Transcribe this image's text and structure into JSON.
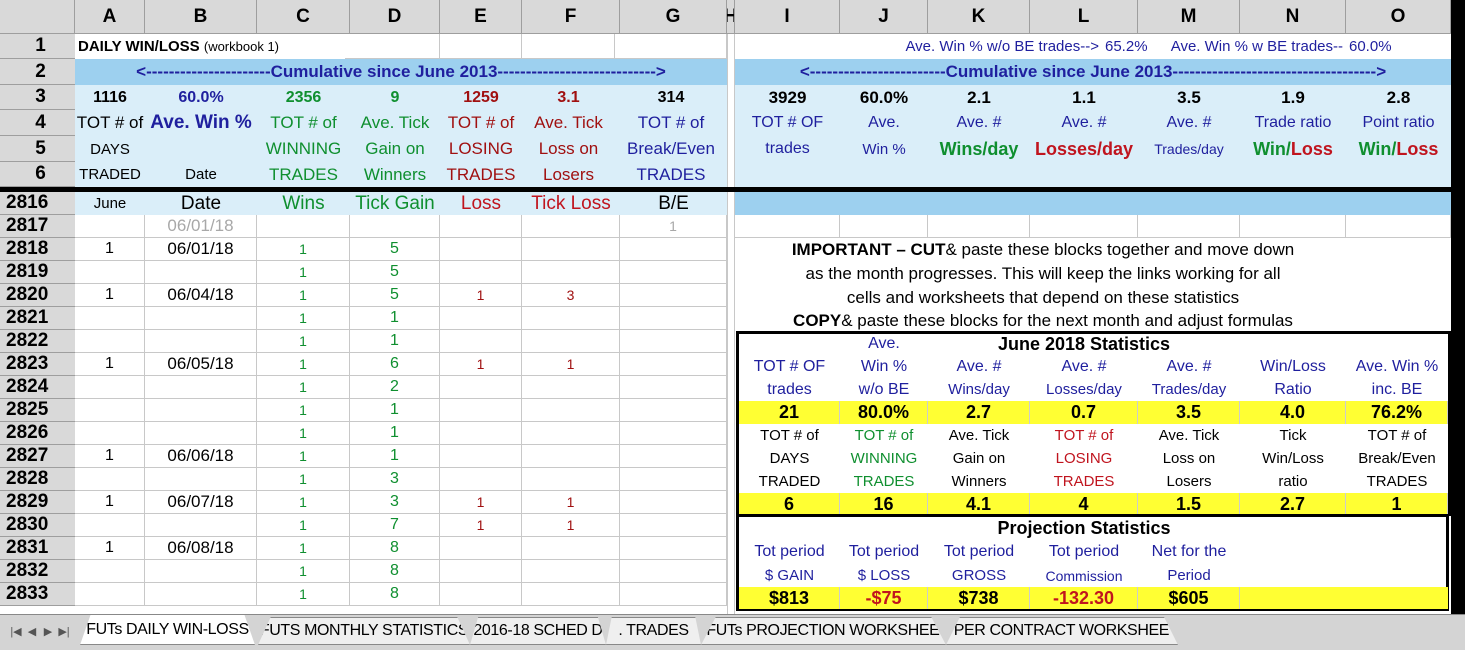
{
  "columns": [
    "A",
    "B",
    "C",
    "D",
    "E",
    "F",
    "G",
    "H",
    "I",
    "J",
    "K",
    "L",
    "M",
    "N",
    "O"
  ],
  "row_nums_top": [
    "1",
    "2",
    "3",
    "4",
    "5",
    "6"
  ],
  "title": {
    "main": "DAILY WIN/LOSS",
    "sub": "(workbook 1)"
  },
  "row1_right": {
    "a": "Ave. Win % w/o BE trades-->",
    "b": "65.2%",
    "c": "Ave. Win % w BE trades--",
    "d": "60.0%"
  },
  "banner": {
    "left": "<----------------------Cumulative since June 2013---------------------------->",
    "right": "<------------------------Cumulative since June 2013------------------------------------>"
  },
  "summary_left": [
    "1116",
    "60.0%",
    "2356",
    "9",
    "1259",
    "3.1",
    "314"
  ],
  "summary_right": [
    "3929",
    "60.0%",
    "2.1",
    "1.1",
    "3.5",
    "1.9",
    "2.8"
  ],
  "hdr4_left": [
    "TOT # of",
    "Ave. Win %",
    "TOT # of",
    "Ave. Tick",
    "TOT # of",
    "Ave. Tick",
    "TOT # of"
  ],
  "hdr5_left": [
    "DAYS",
    "",
    "WINNING",
    "Gain on",
    "LOSING",
    "Loss on",
    "Break/Even"
  ],
  "hdr6_left": [
    "TRADED",
    "Date",
    "TRADES",
    "Winners",
    "TRADES",
    "Losers",
    "TRADES"
  ],
  "hdr4_right": [
    "TOT # OF",
    "Ave.",
    "Ave. #",
    "Ave. #",
    "Ave. #",
    "Trade ratio",
    "Point ratio"
  ],
  "hdr5_right": [
    "trades",
    "Win %",
    "Wins/day",
    "Losses/day",
    "Trades/day",
    "Win/",
    "Loss",
    "Win/",
    "Loss"
  ],
  "month_header": {
    "row": "2816",
    "a": "June",
    "b": "Date",
    "c": "Wins",
    "d": "Tick Gain",
    "e": "Loss",
    "f": "Tick Loss",
    "g": "B/E"
  },
  "rows": [
    {
      "n": "2817",
      "a": "",
      "b": "06/01/18",
      "c": "",
      "d": "",
      "e": "",
      "f": "",
      "g": "1"
    },
    {
      "n": "2818",
      "a": "1",
      "b": "06/01/18",
      "c": "1",
      "d": "5",
      "e": "",
      "f": "",
      "g": ""
    },
    {
      "n": "2819",
      "a": "",
      "b": "",
      "c": "1",
      "d": "5",
      "e": "",
      "f": "",
      "g": ""
    },
    {
      "n": "2820",
      "a": "1",
      "b": "06/04/18",
      "c": "1",
      "d": "5",
      "e": "1",
      "f": "3",
      "g": ""
    },
    {
      "n": "2821",
      "a": "",
      "b": "",
      "c": "1",
      "d": "1",
      "e": "",
      "f": "",
      "g": ""
    },
    {
      "n": "2822",
      "a": "",
      "b": "",
      "c": "1",
      "d": "1",
      "e": "",
      "f": "",
      "g": ""
    },
    {
      "n": "2823",
      "a": "1",
      "b": "06/05/18",
      "c": "1",
      "d": "6",
      "e": "1",
      "f": "1",
      "g": ""
    },
    {
      "n": "2824",
      "a": "",
      "b": "",
      "c": "1",
      "d": "2",
      "e": "",
      "f": "",
      "g": ""
    },
    {
      "n": "2825",
      "a": "",
      "b": "",
      "c": "1",
      "d": "1",
      "e": "",
      "f": "",
      "g": ""
    },
    {
      "n": "2826",
      "a": "",
      "b": "",
      "c": "1",
      "d": "1",
      "e": "",
      "f": "",
      "g": ""
    },
    {
      "n": "2827",
      "a": "1",
      "b": "06/06/18",
      "c": "1",
      "d": "1",
      "e": "",
      "f": "",
      "g": ""
    },
    {
      "n": "2828",
      "a": "",
      "b": "",
      "c": "1",
      "d": "3",
      "e": "",
      "f": "",
      "g": ""
    },
    {
      "n": "2829",
      "a": "1",
      "b": "06/07/18",
      "c": "1",
      "d": "3",
      "e": "1",
      "f": "1",
      "g": ""
    },
    {
      "n": "2830",
      "a": "",
      "b": "",
      "c": "1",
      "d": "7",
      "e": "1",
      "f": "1",
      "g": ""
    },
    {
      "n": "2831",
      "a": "1",
      "b": "06/08/18",
      "c": "1",
      "d": "8",
      "e": "",
      "f": "",
      "g": ""
    },
    {
      "n": "2832",
      "a": "",
      "b": "",
      "c": "1",
      "d": "8",
      "e": "",
      "f": "",
      "g": ""
    },
    {
      "n": "2833",
      "a": "",
      "b": "",
      "c": "1",
      "d": "8",
      "e": "",
      "f": "",
      "g": ""
    }
  ],
  "notice": {
    "l1_bold": "IMPORTANT – CUT",
    "l1_mid": " & paste these blocks together and move down",
    "l2": "as the month progresses. This will keep the links working for all",
    "l3": "cells and worksheets that depend on these statistics",
    "l4_bold": "COPY",
    "l4_rest": " & paste these blocks for the next month and adjust formulas"
  },
  "june_stats": {
    "title": "June 2018 Statistics",
    "ave_label": "Ave.",
    "h1": [
      "TOT # OF",
      "Win %",
      "Ave. #",
      "Ave. #",
      "Ave. #",
      "Win/Loss",
      "Ave. Win %"
    ],
    "h2": [
      "trades",
      "w/o BE",
      "Wins/day",
      "Losses/day",
      "Trades/day",
      "Ratio",
      "inc. BE"
    ],
    "v1": [
      "21",
      "80.0%",
      "2.7",
      "0.7",
      "3.5",
      "4.0",
      "76.2%"
    ],
    "g1": [
      "TOT # of",
      "TOT # of",
      "Ave. Tick",
      "TOT # of",
      "Ave. Tick",
      "Tick",
      "TOT # of"
    ],
    "g2": [
      "DAYS",
      "WINNING",
      "Gain on",
      "LOSING",
      "Loss on",
      "Win/Loss",
      "Break/Even"
    ],
    "g3": [
      "TRADED",
      "TRADES",
      "Winners",
      "TRADES",
      "Losers",
      "ratio",
      "TRADES"
    ],
    "v2": [
      "6",
      "16",
      "4.1",
      "4",
      "1.5",
      "2.7",
      "1"
    ]
  },
  "projection": {
    "title": "Projection Statistics",
    "h1": [
      "Tot period",
      "Tot period",
      "Tot period",
      "Tot period",
      "Net for the"
    ],
    "h2": [
      "$ GAIN",
      "$ LOSS",
      "GROSS",
      "Commission",
      "Period"
    ],
    "v": [
      "$813",
      "-$75",
      "$738",
      "-132.30",
      "$605"
    ]
  },
  "tabs": [
    "FUTs DAILY WIN-LOSS",
    "FUTS MONTHLY STATISTICS",
    "2016-18 SCHED D",
    ".  TRADES",
    ".  FUTs PROJECTION WORKSHEET",
    ".  PER CONTRACT WORKSHEET"
  ],
  "colors": {
    "band": "#9dd0ef",
    "light": "#daeef9",
    "yellow": "#ffff33",
    "blue": "#1f1f9e",
    "green": "#0f8f2f",
    "red": "#c0141e"
  }
}
